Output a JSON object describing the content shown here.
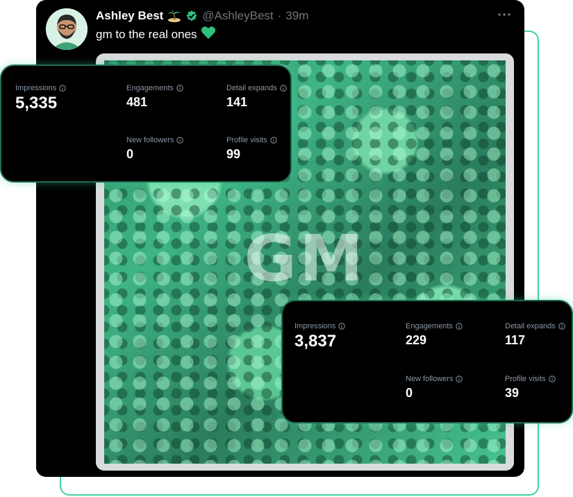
{
  "tweet": {
    "author_name": "Ashley Best",
    "author_badges": [
      "island-emoji",
      "verified-badge-icon"
    ],
    "handle": "@AshleyBest",
    "separator": "·",
    "timestamp": "39m",
    "text": "gm to the real ones",
    "text_emoji": "green-heart-icon",
    "media_overlay_text": "GM"
  },
  "stats_cards": [
    {
      "impressions_label": "Impressions",
      "impressions_value": "5,335",
      "engagements_label": "Engagements",
      "engagements_value": "481",
      "detail_expands_label": "Detail expands",
      "detail_expands_value": "141",
      "new_followers_label": "New followers",
      "new_followers_value": "0",
      "profile_visits_label": "Profile visits",
      "profile_visits_value": "99"
    },
    {
      "impressions_label": "Impressions",
      "impressions_value": "3,837",
      "engagements_label": "Engagements",
      "engagements_value": "229",
      "detail_expands_label": "Detail expands",
      "detail_expands_value": "117",
      "new_followers_label": "New followers",
      "new_followers_value": "0",
      "profile_visits_label": "Profile visits",
      "profile_visits_value": "39"
    }
  ],
  "colors": {
    "accent_green": "#3fd19a",
    "card_background": "#000000",
    "muted_text": "#8b98a5",
    "verified_badge": "#2fc07e"
  }
}
